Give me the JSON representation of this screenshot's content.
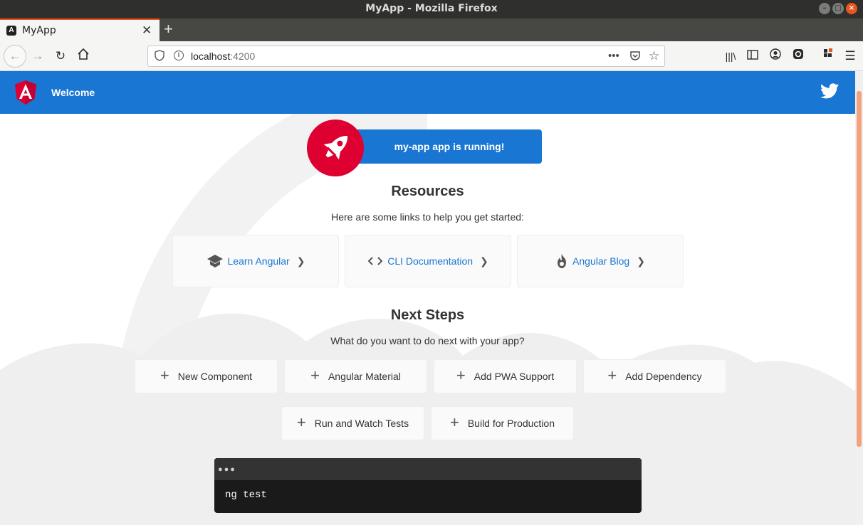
{
  "window": {
    "title": "MyApp - Mozilla Firefox"
  },
  "tab": {
    "title": "MyApp"
  },
  "urlbar": {
    "host": "localhost",
    "port": ":4200"
  },
  "header": {
    "welcome": "Welcome"
  },
  "banner": {
    "text": "my-app app is running!"
  },
  "resources": {
    "title": "Resources",
    "subtitle": "Here are some links to help you get started:",
    "cards": [
      {
        "label": "Learn Angular",
        "icon": "school-icon"
      },
      {
        "label": "CLI Documentation",
        "icon": "code-icon"
      },
      {
        "label": "Angular Blog",
        "icon": "fire-icon"
      }
    ]
  },
  "next_steps": {
    "title": "Next Steps",
    "subtitle": "What do you want to do next with your app?",
    "items": [
      {
        "label": "New Component"
      },
      {
        "label": "Angular Material"
      },
      {
        "label": "Add PWA Support"
      },
      {
        "label": "Add Dependency"
      },
      {
        "label": "Run and Watch Tests"
      },
      {
        "label": "Build for Production"
      }
    ]
  },
  "terminal": {
    "command": "ng test"
  },
  "colors": {
    "primary": "#1976d2",
    "accent": "#dd0031",
    "firefox_accent": "#e95420"
  }
}
